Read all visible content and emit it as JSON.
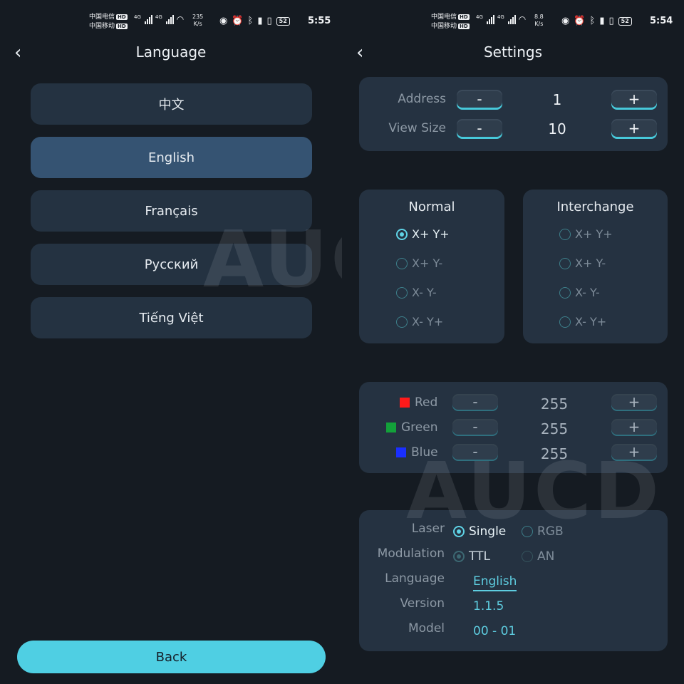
{
  "status_left": {
    "carrier1": "中国电信",
    "carrier2": "中国移动",
    "hd": "HD",
    "net1": "4G",
    "net2": "4G",
    "speed_value": "235",
    "speed_unit": "K/s",
    "battery": "52",
    "time": "5:55"
  },
  "status_right": {
    "carrier1": "中国电信",
    "carrier2": "中国移动",
    "hd": "HD",
    "net1": "4G",
    "net2": "4G",
    "speed_value": "8.8",
    "speed_unit": "K/s",
    "battery": "52",
    "time": "5:54"
  },
  "language_screen": {
    "title": "Language",
    "items": [
      {
        "label": "中文"
      },
      {
        "label": "English"
      },
      {
        "label": "Français"
      },
      {
        "label": "Русский"
      },
      {
        "label": "Tiếng Việt"
      }
    ],
    "selected_index": 1,
    "back_label": "Back"
  },
  "settings_screen": {
    "title": "Settings",
    "address": {
      "label": "Address",
      "value": "1",
      "minus": "-",
      "plus": "+"
    },
    "view_size": {
      "label": "View Size",
      "value": "10",
      "minus": "-",
      "plus": "+"
    },
    "normal": {
      "title": "Normal",
      "options": [
        "X+ Y+",
        "X+ Y-",
        "X- Y-",
        "X- Y+"
      ],
      "selected_index": 0
    },
    "interchange": {
      "title": "Interchange",
      "options": [
        "X+ Y+",
        "X+ Y-",
        "X- Y-",
        "X- Y+"
      ],
      "selected_index": -1
    },
    "colors": [
      {
        "label": "Red",
        "value": "255",
        "swatch": "#ff1a1a",
        "minus": "-",
        "plus": "+"
      },
      {
        "label": "Green",
        "value": "255",
        "swatch": "#13a13a",
        "minus": "-",
        "plus": "+"
      },
      {
        "label": "Blue",
        "value": "255",
        "swatch": "#1a2fff",
        "minus": "-",
        "plus": "+"
      }
    ],
    "laser": {
      "label": "Laser",
      "options": [
        "Single",
        "RGB"
      ],
      "selected": "Single"
    },
    "modulation": {
      "label": "Modulation",
      "options": [
        "TTL",
        "AN"
      ],
      "selected": "TTL"
    },
    "language": {
      "label": "Language",
      "value": "English"
    },
    "version": {
      "label": "Version",
      "value": "1.1.5"
    },
    "model": {
      "label": "Model",
      "value": "00 - 01"
    }
  },
  "watermark": "AUCD",
  "accent_color": "#4fcfe3"
}
